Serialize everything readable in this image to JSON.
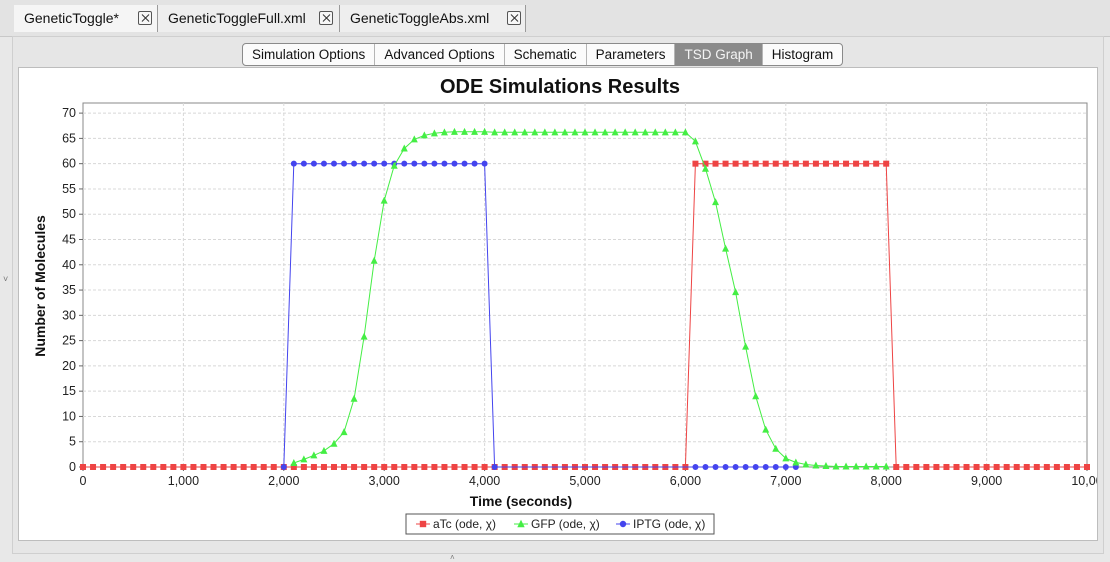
{
  "file_tabs": [
    {
      "label": "GeneticToggle*",
      "active": true
    },
    {
      "label": "GeneticToggleFull.xml",
      "active": false
    },
    {
      "label": "GeneticToggleAbs.xml",
      "active": false
    }
  ],
  "view_tabs": [
    {
      "label": "Simulation Options",
      "selected": false
    },
    {
      "label": "Advanced Options",
      "selected": false
    },
    {
      "label": "Schematic",
      "selected": false
    },
    {
      "label": "Parameters",
      "selected": false
    },
    {
      "label": "TSD Graph",
      "selected": true
    },
    {
      "label": "Histogram",
      "selected": false
    }
  ],
  "chart_data": {
    "type": "line",
    "title": "ODE Simulations Results",
    "xlabel": "Time (seconds)",
    "ylabel": "Number of Molecules",
    "xlim": [
      0,
      10000
    ],
    "ylim": [
      0,
      72
    ],
    "xticks": [
      0,
      1000,
      2000,
      3000,
      4000,
      5000,
      6000,
      7000,
      8000,
      9000,
      10000
    ],
    "xtick_labels": [
      "0",
      "1,000",
      "2,000",
      "3,000",
      "4,000",
      "5,000",
      "6,000",
      "7,000",
      "8,000",
      "9,000",
      "10,00"
    ],
    "yticks": [
      0,
      5,
      10,
      15,
      20,
      25,
      30,
      35,
      40,
      45,
      50,
      55,
      60,
      65,
      70
    ],
    "grid": true,
    "legend_position": "bottom-center",
    "series": [
      {
        "name": "aTc (ode, χ)",
        "color": "#ee4444",
        "marker": "square",
        "x": [
          0,
          100,
          200,
          300,
          400,
          500,
          600,
          700,
          800,
          900,
          1000,
          1100,
          1200,
          1300,
          1400,
          1500,
          1600,
          1700,
          1800,
          1900,
          2000,
          2100,
          2200,
          2300,
          2400,
          2500,
          2600,
          2700,
          2800,
          2900,
          3000,
          3100,
          3200,
          3300,
          3400,
          3500,
          3600,
          3700,
          3800,
          3900,
          4000,
          4100,
          4200,
          4300,
          4400,
          4500,
          4600,
          4700,
          4800,
          4900,
          5000,
          5100,
          5200,
          5300,
          5400,
          5500,
          5600,
          5700,
          5800,
          5900,
          6000,
          6100,
          6200,
          6300,
          6400,
          6500,
          6600,
          6700,
          6800,
          6900,
          7000,
          7100,
          7200,
          7300,
          7400,
          7500,
          7600,
          7700,
          7800,
          7900,
          8000,
          8100,
          8200,
          8300,
          8400,
          8500,
          8600,
          8700,
          8800,
          8900,
          9000,
          9100,
          9200,
          9300,
          9400,
          9500,
          9600,
          9700,
          9800,
          9900,
          10000
        ],
        "y": [
          0,
          0,
          0,
          0,
          0,
          0,
          0,
          0,
          0,
          0,
          0,
          0,
          0,
          0,
          0,
          0,
          0,
          0,
          0,
          0,
          0,
          0,
          0,
          0,
          0,
          0,
          0,
          0,
          0,
          0,
          0,
          0,
          0,
          0,
          0,
          0,
          0,
          0,
          0,
          0,
          0,
          0,
          0,
          0,
          0,
          0,
          0,
          0,
          0,
          0,
          0,
          0,
          0,
          0,
          0,
          0,
          0,
          0,
          0,
          0,
          0,
          60,
          60,
          60,
          60,
          60,
          60,
          60,
          60,
          60,
          60,
          60,
          60,
          60,
          60,
          60,
          60,
          60,
          60,
          60,
          60,
          0,
          0,
          0,
          0,
          0,
          0,
          0,
          0,
          0,
          0,
          0,
          0,
          0,
          0,
          0,
          0,
          0,
          0,
          0,
          0
        ]
      },
      {
        "name": "GFP (ode, χ)",
        "color": "#44ee44",
        "marker": "triangle",
        "x": [
          2100,
          2200,
          2300,
          2400,
          2500,
          2600,
          2700,
          2800,
          2900,
          3000,
          3100,
          3200,
          3300,
          3400,
          3500,
          3600,
          3700,
          3800,
          3900,
          4000,
          4100,
          4200,
          4300,
          4400,
          4500,
          4600,
          4700,
          4800,
          4900,
          5000,
          5100,
          5200,
          5300,
          5400,
          5500,
          5600,
          5700,
          5800,
          5900,
          6000,
          6100,
          6200,
          6300,
          6400,
          6500,
          6600,
          6700,
          6800,
          6900,
          7000,
          7100,
          7200,
          7300,
          7400,
          7500,
          7600,
          7700,
          7800,
          7900,
          8000
        ],
        "y": [
          0.8,
          1.5,
          2.3,
          3.2,
          4.6,
          6.9,
          13.5,
          25.8,
          40.8,
          52.7,
          59.6,
          63.0,
          64.8,
          65.6,
          66.0,
          66.2,
          66.3,
          66.3,
          66.3,
          66.3,
          66.2,
          66.2,
          66.2,
          66.2,
          66.2,
          66.2,
          66.2,
          66.2,
          66.2,
          66.2,
          66.2,
          66.2,
          66.2,
          66.2,
          66.2,
          66.2,
          66.2,
          66.2,
          66.2,
          66.2,
          64.4,
          59.0,
          52.4,
          43.2,
          34.6,
          23.8,
          14.0,
          7.4,
          3.6,
          1.7,
          0.9,
          0.5,
          0.3,
          0.2,
          0.1,
          0.1,
          0.1,
          0.1,
          0.1,
          0.1
        ]
      },
      {
        "name": "IPTG (ode, χ)",
        "color": "#4444ee",
        "marker": "circle",
        "x": [
          2000,
          2100,
          2200,
          2300,
          2400,
          2500,
          2600,
          2700,
          2800,
          2900,
          3000,
          3100,
          3200,
          3300,
          3400,
          3500,
          3600,
          3700,
          3800,
          3900,
          4000,
          4100,
          6100,
          6200,
          6300,
          6400,
          6500,
          6600,
          6700,
          6800,
          6900,
          7000,
          7100
        ],
        "y": [
          0,
          60,
          60,
          60,
          60,
          60,
          60,
          60,
          60,
          60,
          60,
          60,
          60,
          60,
          60,
          60,
          60,
          60,
          60,
          60,
          60,
          0,
          0,
          0,
          0,
          0,
          0,
          0,
          0,
          0,
          0,
          0,
          0
        ]
      }
    ]
  }
}
